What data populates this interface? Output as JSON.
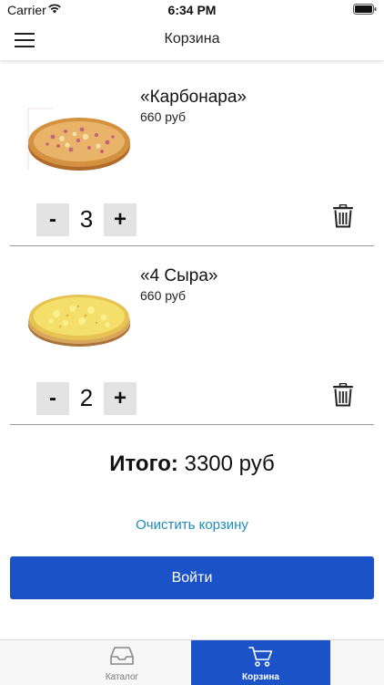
{
  "status_bar": {
    "carrier": "Carrier",
    "time": "6:34 PM"
  },
  "nav": {
    "title": "Корзина",
    "menu_icon": "hamburger-menu-icon"
  },
  "cart": {
    "items": [
      {
        "name": "«Карбонара»",
        "price": "660 руб",
        "quantity": "3",
        "minus_label": "-",
        "plus_label": "+"
      },
      {
        "name": "«4 Сыра»",
        "price": "660 руб",
        "quantity": "2",
        "minus_label": "-",
        "plus_label": "+"
      }
    ],
    "total_label": "Итого:",
    "total_value": "3300 руб",
    "clear_label": "Очистить корзину",
    "login_label": "Войти"
  },
  "tabs": [
    {
      "label": "Каталог",
      "icon": "inbox-tray-icon",
      "active": false
    },
    {
      "label": "Корзина",
      "icon": "shopping-cart-icon",
      "active": true
    }
  ],
  "colors": {
    "accent": "#1b52c7",
    "link": "#1f8bb5",
    "qty_button_bg": "#e3e3e3"
  }
}
